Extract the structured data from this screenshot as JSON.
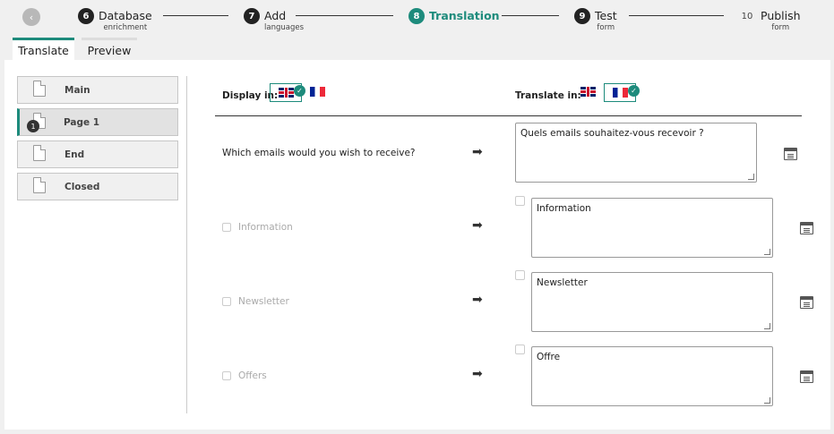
{
  "stepper": {
    "back_icon": "chevron-left-icon",
    "steps": [
      {
        "num": "6",
        "label": "Database",
        "sub": "enrichment"
      },
      {
        "num": "7",
        "label": "Add",
        "sub": "languages"
      },
      {
        "num": "8",
        "label": "Translation",
        "sub": ""
      },
      {
        "num": "9",
        "label": "Test",
        "sub": "form"
      },
      {
        "num": "10",
        "label": "Publish",
        "sub": "form"
      }
    ],
    "active_color": "#1d8b7c"
  },
  "tabs": [
    {
      "label": "Translate",
      "active": true
    },
    {
      "label": "Preview",
      "active": false
    }
  ],
  "pages": [
    {
      "label": "Main"
    },
    {
      "label": "Page 1",
      "active": true,
      "badge": "1"
    },
    {
      "label": "End"
    },
    {
      "label": "Closed"
    }
  ],
  "header": {
    "display_in": "Display in:",
    "translate_in": "Translate in:",
    "display_selected": "english",
    "translate_selected": "french"
  },
  "question": {
    "source": "Which emails would you wish to receive?",
    "translation": "Quels emails souhaitez-vous recevoir ?"
  },
  "options": [
    {
      "source": "Information",
      "translation": "Information"
    },
    {
      "source": "Newsletter",
      "translation": "Newsletter"
    },
    {
      "source": "Offers",
      "translation": "Offre"
    }
  ],
  "icons": {
    "arrow": "double-arrow-right-icon",
    "note": "notes-icon",
    "check": "checkmark-icon"
  }
}
